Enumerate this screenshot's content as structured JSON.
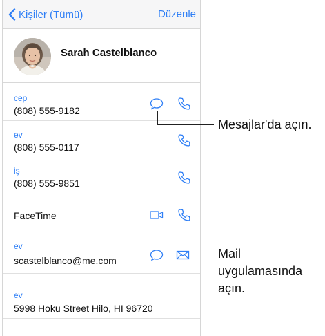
{
  "nav": {
    "back_label": "Kişiler (Tümü)",
    "edit_label": "Düzenle"
  },
  "contact": {
    "name": "Sarah Castelblanco"
  },
  "fields": [
    {
      "label": "cep",
      "value": "(808) 555-9182",
      "actions": [
        "message-icon",
        "phone-icon"
      ]
    },
    {
      "label": "ev",
      "value": "(808) 555-0117",
      "actions": [
        "phone-icon"
      ]
    },
    {
      "label": "iş",
      "value": "(808) 555-9851",
      "actions": [
        "phone-icon"
      ]
    },
    {
      "label": "",
      "value": "FaceTime",
      "actions": [
        "video-icon",
        "phone-icon"
      ]
    },
    {
      "label": "ev",
      "value": "scastelblanco@me.com",
      "actions": [
        "message-icon",
        "mail-icon"
      ]
    },
    {
      "label": "ev",
      "value": "5998 Hoku Street Hilo, HI 96720",
      "actions": []
    }
  ],
  "callouts": {
    "messages": "Mesajlar'da açın.",
    "mail_line1": "Mail",
    "mail_line2": "uygulamasında",
    "mail_line3": "açın."
  },
  "colors": {
    "accent": "#2f7ff6",
    "text": "#111111",
    "separator": "#e0e0e0",
    "navbar_bg": "#f6f6f7"
  }
}
